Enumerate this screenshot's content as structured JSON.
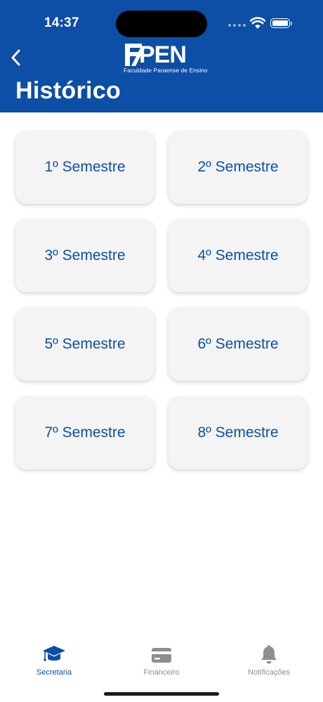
{
  "colors": {
    "brand": "#0d4ea6",
    "tab_inactive": "#8e8e8e"
  },
  "status_bar": {
    "time": "14:37"
  },
  "header": {
    "back_icon": "chevron-left-icon",
    "logo_name": "PEN",
    "logo_subtitle": "Faculdade Paraense de Ensino",
    "title": "Histórico"
  },
  "semesters": [
    {
      "label": "1º Semestre"
    },
    {
      "label": "2º Semestre"
    },
    {
      "label": "3º Semestre"
    },
    {
      "label": "4º Semestre"
    },
    {
      "label": "5º Semestre"
    },
    {
      "label": "6º Semestre"
    },
    {
      "label": "7º Semestre"
    },
    {
      "label": "8º Semestre"
    }
  ],
  "tabbar": {
    "items": [
      {
        "label": "Secretaria",
        "icon": "graduation-cap-icon",
        "active": true
      },
      {
        "label": "Financeiro",
        "icon": "credit-card-icon",
        "active": false
      },
      {
        "label": "Notificações",
        "icon": "bell-icon",
        "active": false
      }
    ]
  }
}
